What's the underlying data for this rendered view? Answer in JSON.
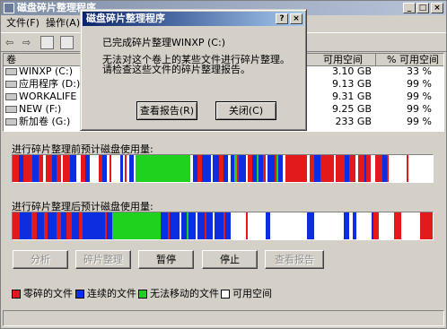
{
  "main_window": {
    "title": "磁盘碎片整理程序",
    "menu": [
      "文件(F)",
      "操作(A)"
    ],
    "columns": {
      "volume": "卷",
      "free_space": "可用空间",
      "pct_free": "% 可用空间"
    },
    "volumes": [
      {
        "name": "WINXP  (C:)",
        "free": "3.10 GB",
        "pct": "33 %"
      },
      {
        "name": "应用程序  (D:)",
        "free": "9.13 GB",
        "pct": "99 %"
      },
      {
        "name": "WORKALIFE  (E:)",
        "free": "9.31 GB",
        "pct": "99 %"
      },
      {
        "name": "NEW  (F:)",
        "free": "9.25 GB",
        "pct": "99 %"
      },
      {
        "name": "新加卷  (G:)",
        "free": "233 GB",
        "pct": "99 %"
      }
    ],
    "before_label": "进行碎片整理前预计磁盘使用量:",
    "after_label": "进行碎片整理后预计磁盘使用量:",
    "buttons": {
      "analyze": "分析",
      "defrag": "碎片整理",
      "pause": "暂停",
      "stop": "停止",
      "view_report": "查看报告"
    },
    "legend": [
      {
        "label": "零碎的文件",
        "color": "#e31a1c"
      },
      {
        "label": "连续的文件",
        "color": "#0b2ee0"
      },
      {
        "label": "无法移动的文件",
        "color": "#1ed21e"
      },
      {
        "label": "可用空间",
        "color": "#ffffff"
      }
    ]
  },
  "dialog": {
    "title": "磁盘碎片整理程序",
    "message_line1": "已完成碎片整理WINXP (C:)",
    "message_line2": "无法对这个卷上的某些文件进行碎片整理。",
    "message_line3": "请检查这些文件的碎片整理报告。",
    "view_report_button": "查看报告(R)",
    "close_button": "关闭(C)"
  },
  "colors": {
    "fragmented": "#e31a1c",
    "contiguous": "#0b2ee0",
    "unmovable": "#1ed21e",
    "free": "#ffffff"
  }
}
